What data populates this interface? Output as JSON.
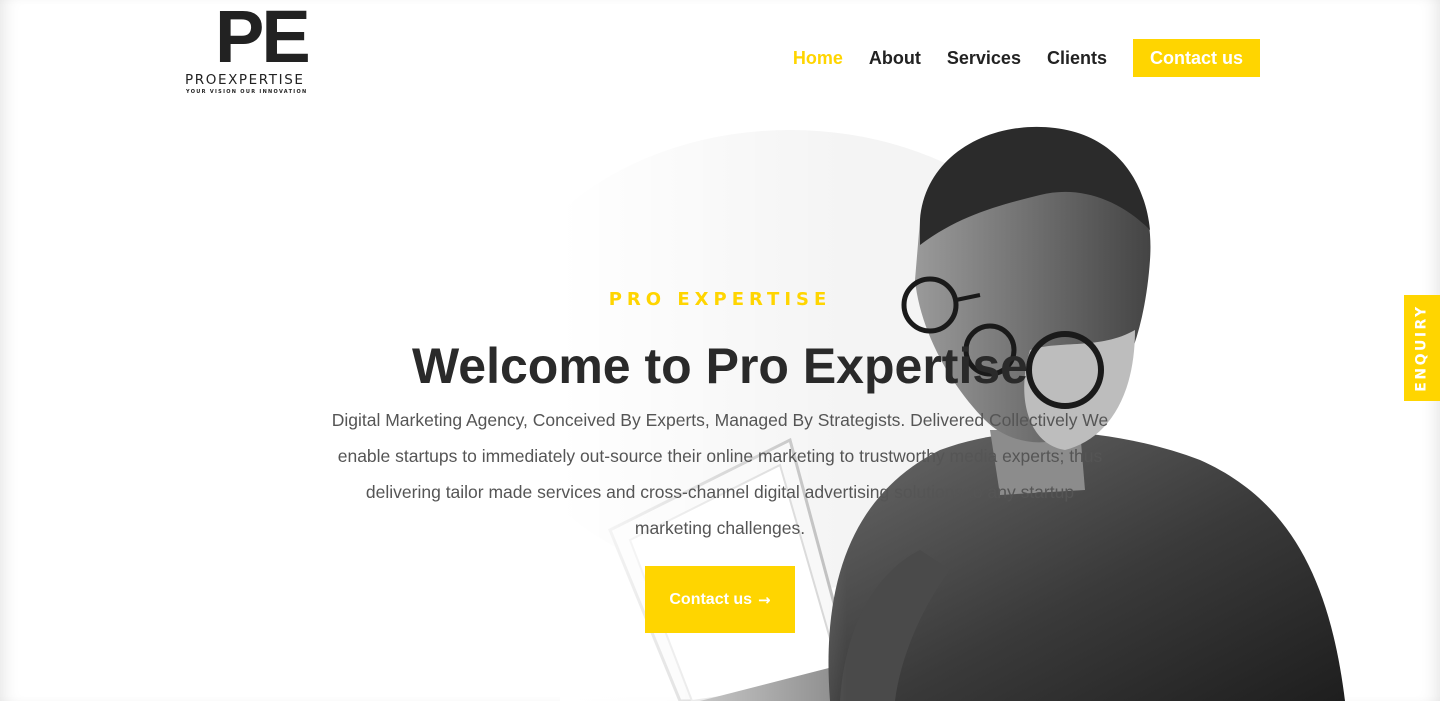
{
  "brand": {
    "mark": "PE",
    "name": "PROEXPERTISE",
    "tagline": "YOUR VISION OUR INNOVATION"
  },
  "nav": {
    "items": [
      {
        "label": "Home",
        "active": true
      },
      {
        "label": "About"
      },
      {
        "label": "Services"
      },
      {
        "label": "Clients"
      }
    ],
    "cta_label": "Contact us"
  },
  "hero": {
    "eyebrow": "PRO EXPERTISE",
    "title": "Welcome to Pro Expertise",
    "description": "Digital Marketing Agency, Conceived By Experts, Managed By Strategists. Delivered Collectively We enable startups to immediately out-source their online marketing to trustworthy media experts; thus delivering tailor made services and cross-channel digital advertising solutions to any startup marketing challenges.",
    "cta_label": "Contact us",
    "cta_icon": "arrow-right-icon",
    "cta_arrow": "→"
  },
  "enquiry": {
    "label": "ENQUIRY"
  },
  "colors": {
    "accent": "#ffd500",
    "text_dark": "#2a2a2a",
    "text_body": "#555555"
  }
}
